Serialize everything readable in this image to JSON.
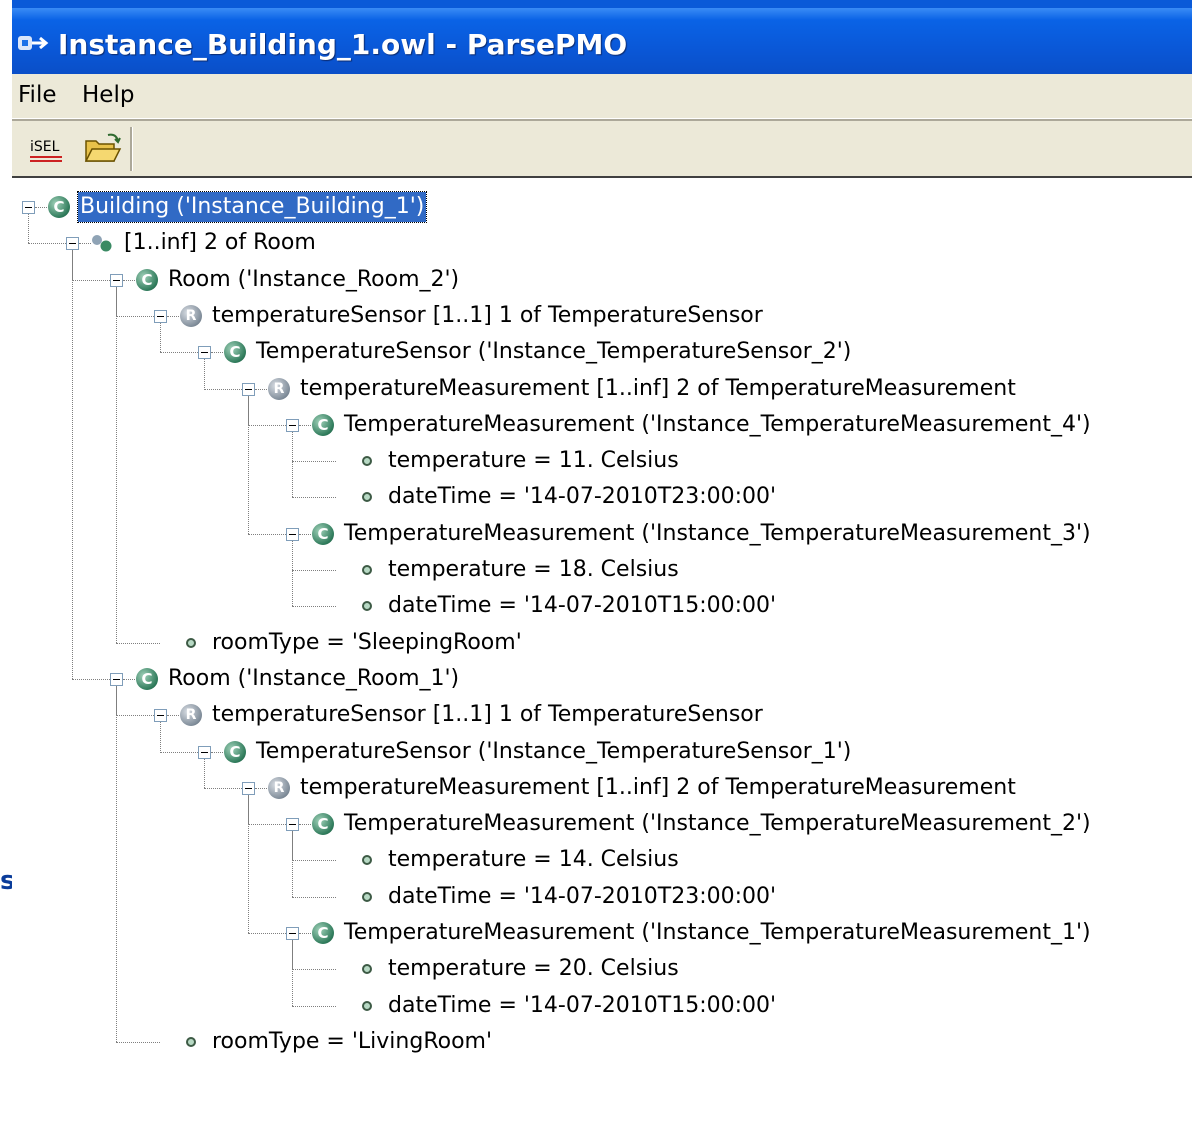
{
  "window": {
    "title": "Instance_Building_1.owl - ParsePMO",
    "icon": "parsepmo-app-icon"
  },
  "menu": [
    "File",
    "Help"
  ],
  "toolbar": {
    "isel_label": "iSEL",
    "open_icon": "open-folder-icon"
  },
  "side_glyph": "s",
  "tree": [
    {
      "depth": 0,
      "icon": "class",
      "label": "Building ('Instance_Building_1')",
      "selected": true
    },
    {
      "depth": 1,
      "icon": "restriction-small",
      "label": "[1..inf] 2 of Room"
    },
    {
      "depth": 2,
      "icon": "class",
      "label": "Room ('Instance_Room_2')"
    },
    {
      "depth": 3,
      "icon": "restriction",
      "label": "temperatureSensor  [1..1] 1 of TemperatureSensor"
    },
    {
      "depth": 4,
      "icon": "class",
      "label": "TemperatureSensor ('Instance_TemperatureSensor_2')"
    },
    {
      "depth": 5,
      "icon": "restriction",
      "label": "temperatureMeasurement  [1..inf] 2 of TemperatureMeasurement"
    },
    {
      "depth": 6,
      "icon": "class",
      "label": "TemperatureMeasurement ('Instance_TemperatureMeasurement_4')"
    },
    {
      "depth": 7,
      "icon": "property",
      "label": "temperature = 11. Celsius"
    },
    {
      "depth": 7,
      "icon": "property",
      "label": "dateTime = '14-07-2010T23:00:00'"
    },
    {
      "depth": 6,
      "icon": "class",
      "label": "TemperatureMeasurement ('Instance_TemperatureMeasurement_3')"
    },
    {
      "depth": 7,
      "icon": "property",
      "label": "temperature = 18. Celsius"
    },
    {
      "depth": 7,
      "icon": "property",
      "label": "dateTime = '14-07-2010T15:00:00'"
    },
    {
      "depth": 3,
      "icon": "property",
      "label": "roomType = 'SleepingRoom'"
    },
    {
      "depth": 2,
      "icon": "class",
      "label": "Room ('Instance_Room_1')"
    },
    {
      "depth": 3,
      "icon": "restriction",
      "label": "temperatureSensor  [1..1] 1 of TemperatureSensor"
    },
    {
      "depth": 4,
      "icon": "class",
      "label": "TemperatureSensor ('Instance_TemperatureSensor_1')"
    },
    {
      "depth": 5,
      "icon": "restriction",
      "label": "temperatureMeasurement  [1..inf] 2 of TemperatureMeasurement"
    },
    {
      "depth": 6,
      "icon": "class",
      "label": "TemperatureMeasurement ('Instance_TemperatureMeasurement_2')"
    },
    {
      "depth": 7,
      "icon": "property",
      "label": "temperature = 14. Celsius"
    },
    {
      "depth": 7,
      "icon": "property",
      "label": "dateTime = '14-07-2010T23:00:00'"
    },
    {
      "depth": 6,
      "icon": "class",
      "label": "TemperatureMeasurement ('Instance_TemperatureMeasurement_1')"
    },
    {
      "depth": 7,
      "icon": "property",
      "label": "temperature = 20. Celsius"
    },
    {
      "depth": 7,
      "icon": "property",
      "label": "dateTime = '14-07-2010T15:00:00'"
    },
    {
      "depth": 3,
      "icon": "property",
      "label": "roomType = 'LivingRoom'"
    }
  ],
  "colors": {
    "titlebar": "#0a58d8",
    "selection": "#316ac5",
    "chrome": "#ece9d8"
  }
}
